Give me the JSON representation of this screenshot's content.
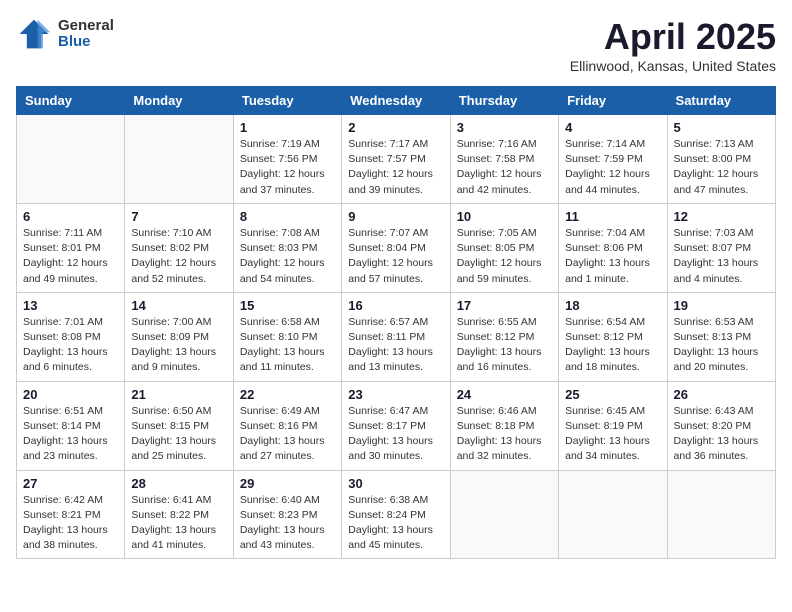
{
  "header": {
    "logo_general": "General",
    "logo_blue": "Blue",
    "month": "April 2025",
    "location": "Ellinwood, Kansas, United States"
  },
  "days_of_week": [
    "Sunday",
    "Monday",
    "Tuesday",
    "Wednesday",
    "Thursday",
    "Friday",
    "Saturday"
  ],
  "weeks": [
    [
      {
        "day": "",
        "info": ""
      },
      {
        "day": "",
        "info": ""
      },
      {
        "day": "1",
        "info": "Sunrise: 7:19 AM\nSunset: 7:56 PM\nDaylight: 12 hours and 37 minutes."
      },
      {
        "day": "2",
        "info": "Sunrise: 7:17 AM\nSunset: 7:57 PM\nDaylight: 12 hours and 39 minutes."
      },
      {
        "day": "3",
        "info": "Sunrise: 7:16 AM\nSunset: 7:58 PM\nDaylight: 12 hours and 42 minutes."
      },
      {
        "day": "4",
        "info": "Sunrise: 7:14 AM\nSunset: 7:59 PM\nDaylight: 12 hours and 44 minutes."
      },
      {
        "day": "5",
        "info": "Sunrise: 7:13 AM\nSunset: 8:00 PM\nDaylight: 12 hours and 47 minutes."
      }
    ],
    [
      {
        "day": "6",
        "info": "Sunrise: 7:11 AM\nSunset: 8:01 PM\nDaylight: 12 hours and 49 minutes."
      },
      {
        "day": "7",
        "info": "Sunrise: 7:10 AM\nSunset: 8:02 PM\nDaylight: 12 hours and 52 minutes."
      },
      {
        "day": "8",
        "info": "Sunrise: 7:08 AM\nSunset: 8:03 PM\nDaylight: 12 hours and 54 minutes."
      },
      {
        "day": "9",
        "info": "Sunrise: 7:07 AM\nSunset: 8:04 PM\nDaylight: 12 hours and 57 minutes."
      },
      {
        "day": "10",
        "info": "Sunrise: 7:05 AM\nSunset: 8:05 PM\nDaylight: 12 hours and 59 minutes."
      },
      {
        "day": "11",
        "info": "Sunrise: 7:04 AM\nSunset: 8:06 PM\nDaylight: 13 hours and 1 minute."
      },
      {
        "day": "12",
        "info": "Sunrise: 7:03 AM\nSunset: 8:07 PM\nDaylight: 13 hours and 4 minutes."
      }
    ],
    [
      {
        "day": "13",
        "info": "Sunrise: 7:01 AM\nSunset: 8:08 PM\nDaylight: 13 hours and 6 minutes."
      },
      {
        "day": "14",
        "info": "Sunrise: 7:00 AM\nSunset: 8:09 PM\nDaylight: 13 hours and 9 minutes."
      },
      {
        "day": "15",
        "info": "Sunrise: 6:58 AM\nSunset: 8:10 PM\nDaylight: 13 hours and 11 minutes."
      },
      {
        "day": "16",
        "info": "Sunrise: 6:57 AM\nSunset: 8:11 PM\nDaylight: 13 hours and 13 minutes."
      },
      {
        "day": "17",
        "info": "Sunrise: 6:55 AM\nSunset: 8:12 PM\nDaylight: 13 hours and 16 minutes."
      },
      {
        "day": "18",
        "info": "Sunrise: 6:54 AM\nSunset: 8:12 PM\nDaylight: 13 hours and 18 minutes."
      },
      {
        "day": "19",
        "info": "Sunrise: 6:53 AM\nSunset: 8:13 PM\nDaylight: 13 hours and 20 minutes."
      }
    ],
    [
      {
        "day": "20",
        "info": "Sunrise: 6:51 AM\nSunset: 8:14 PM\nDaylight: 13 hours and 23 minutes."
      },
      {
        "day": "21",
        "info": "Sunrise: 6:50 AM\nSunset: 8:15 PM\nDaylight: 13 hours and 25 minutes."
      },
      {
        "day": "22",
        "info": "Sunrise: 6:49 AM\nSunset: 8:16 PM\nDaylight: 13 hours and 27 minutes."
      },
      {
        "day": "23",
        "info": "Sunrise: 6:47 AM\nSunset: 8:17 PM\nDaylight: 13 hours and 30 minutes."
      },
      {
        "day": "24",
        "info": "Sunrise: 6:46 AM\nSunset: 8:18 PM\nDaylight: 13 hours and 32 minutes."
      },
      {
        "day": "25",
        "info": "Sunrise: 6:45 AM\nSunset: 8:19 PM\nDaylight: 13 hours and 34 minutes."
      },
      {
        "day": "26",
        "info": "Sunrise: 6:43 AM\nSunset: 8:20 PM\nDaylight: 13 hours and 36 minutes."
      }
    ],
    [
      {
        "day": "27",
        "info": "Sunrise: 6:42 AM\nSunset: 8:21 PM\nDaylight: 13 hours and 38 minutes."
      },
      {
        "day": "28",
        "info": "Sunrise: 6:41 AM\nSunset: 8:22 PM\nDaylight: 13 hours and 41 minutes."
      },
      {
        "day": "29",
        "info": "Sunrise: 6:40 AM\nSunset: 8:23 PM\nDaylight: 13 hours and 43 minutes."
      },
      {
        "day": "30",
        "info": "Sunrise: 6:38 AM\nSunset: 8:24 PM\nDaylight: 13 hours and 45 minutes."
      },
      {
        "day": "",
        "info": ""
      },
      {
        "day": "",
        "info": ""
      },
      {
        "day": "",
        "info": ""
      }
    ]
  ]
}
